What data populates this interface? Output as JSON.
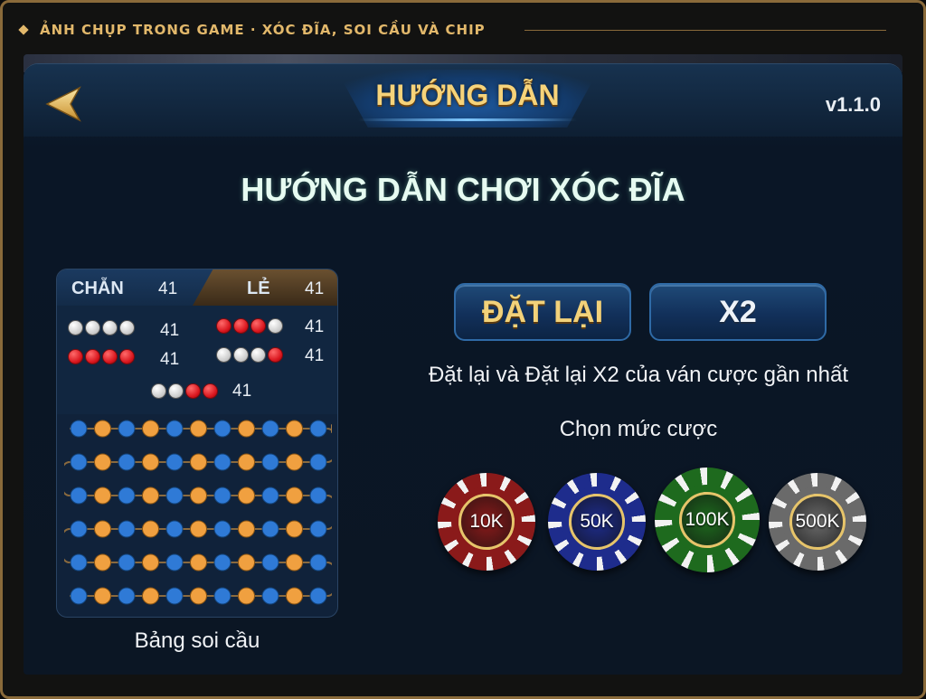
{
  "caption": "ẢNH CHỤP TRONG GAME · XÓC ĐĨA, SOI CẦU VÀ CHIP",
  "header": {
    "title": "HƯỚNG DẪN",
    "version": "v1.1.0"
  },
  "guide": {
    "heading": "HƯỚNG DẪN CHƠI XÓC ĐĨA"
  },
  "board": {
    "even_label": "CHẴN",
    "even_count": "41",
    "odd_label": "LẺ",
    "odd_count": "41",
    "combos": [
      {
        "pattern": "4 trắng",
        "count": "41"
      },
      {
        "pattern": "4 đỏ",
        "count": "41"
      },
      {
        "pattern": "3 đỏ 1 trắng",
        "count": "41"
      },
      {
        "pattern": "3 trắng 1 đỏ",
        "count": "41"
      },
      {
        "pattern": "2 trắng 2 đỏ",
        "count": "41"
      }
    ],
    "caption": "Bảng soi cầu",
    "colors": {
      "blue": "#2f7ad6",
      "orange": "#f0a040"
    }
  },
  "buttons": {
    "reset": "ĐẶT LẠI",
    "double": "X2"
  },
  "text": {
    "reset_desc": "Đặt lại và Đặt lại X2 của ván cược gần nhất",
    "choose_bet": "Chọn mức cược"
  },
  "chips": [
    {
      "label": "10K",
      "color": "#8a1a1a"
    },
    {
      "label": "50K",
      "color": "#1e2c8c"
    },
    {
      "label": "100K",
      "color": "#1e6a1e"
    },
    {
      "label": "500K",
      "color": "#6a6a6a"
    }
  ],
  "icons": {
    "back": "back-arrow-icon"
  }
}
